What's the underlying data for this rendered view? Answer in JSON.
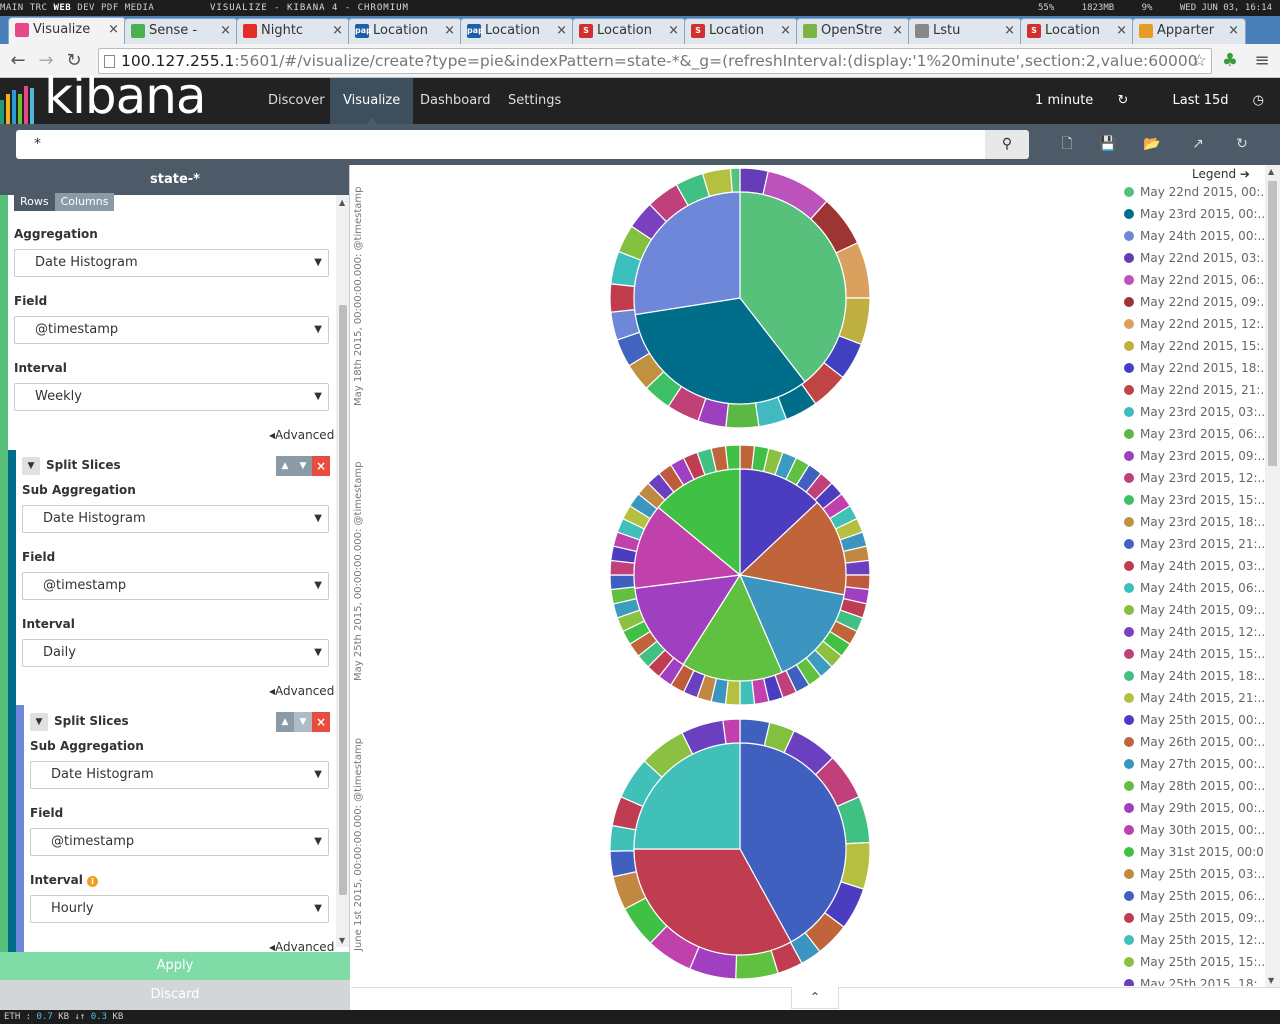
{
  "system_bar": {
    "workspaces": [
      "MAIN",
      "TRC",
      "WEB",
      "DEV",
      "PDF",
      "MEDIA"
    ],
    "active_workspace": "WEB",
    "window_title": "VISUALIZE - KIBANA 4 - CHROMIUM",
    "volume": "55%",
    "memory": "1823MB",
    "cpu": "9%",
    "datetime": "WED JUN 03, 16:14"
  },
  "browser": {
    "tabs": [
      {
        "label": "Visualize",
        "icon_color": "#e8488b",
        "active": true
      },
      {
        "label": "Sense - ",
        "icon_color": "#4caf50",
        "active": false
      },
      {
        "label": "Nightc",
        "icon_color": "#e52d27",
        "active": false
      },
      {
        "label": "Location",
        "icon_color": "#1c5fa8",
        "icon_text": "pap",
        "active": false
      },
      {
        "label": "Location",
        "icon_color": "#1c5fa8",
        "icon_text": "pap",
        "active": false
      },
      {
        "label": "Location",
        "icon_color": "#d32f2f",
        "icon_text": "S",
        "active": false
      },
      {
        "label": "Location",
        "icon_color": "#d32f2f",
        "icon_text": "S",
        "active": false
      },
      {
        "label": "OpenStre",
        "icon_color": "#7cb342",
        "active": false
      },
      {
        "label": "Lstu",
        "icon_color": "#888888",
        "active": false
      },
      {
        "label": "Location",
        "icon_color": "#d32f2f",
        "icon_text": "S",
        "active": false
      },
      {
        "label": "Apparter",
        "icon_color": "#e69c24",
        "active": false
      }
    ],
    "url_host": "100.127.255.1",
    "url_rest": ":5601/#/visualize/create?type=pie&indexPattern=state-*&_g=(refreshInterval:(display:'1%20minute',section:2,value:60000"
  },
  "kibana": {
    "logo": "kibana",
    "nav": [
      "Discover",
      "Visualize",
      "Dashboard",
      "Settings"
    ],
    "active_nav": "Visualize",
    "refresh_label": "1 minute",
    "time_label": "Last 15d",
    "search_value": "*"
  },
  "sidebar": {
    "title": "state-*",
    "rows_label": "Rows",
    "columns_label": "Columns",
    "aggregation_label": "Aggregation",
    "aggregation_value": "Date Histogram",
    "field_label": "Field",
    "field_value": "@timestamp",
    "interval_label": "Interval",
    "interval_value": "Weekly",
    "advanced_label": "Advanced",
    "split1": {
      "title": "Split Slices",
      "sub_agg_label": "Sub Aggregation",
      "sub_agg_value": "Date Histogram",
      "field_label": "Field",
      "field_value": "@timestamp",
      "interval_label": "Interval",
      "interval_value": "Daily",
      "advanced_label": "Advanced"
    },
    "split2": {
      "title": "Split Slices",
      "sub_agg_label": "Sub Aggregation",
      "sub_agg_value": "Date Histogram",
      "field_label": "Field",
      "field_value": "@timestamp",
      "interval_label": "Interval",
      "interval_value": "Hourly",
      "advanced_label": "Advanced"
    },
    "apply_label": "Apply",
    "discard_label": "Discard"
  },
  "charts": {
    "row_labels": [
      "May 18th 2015, 00:00:00.000: @timestamp",
      "May 25th 2015, 00:00:00.000: @timestamp",
      "June 1st 2015, 00:00:00.000: @timestamp"
    ],
    "legend_title": "Legend",
    "legend": [
      {
        "label": "May 22nd 2015, 00:...",
        "color": "#57c17b"
      },
      {
        "label": "May 23rd 2015, 00:...",
        "color": "#006e8a"
      },
      {
        "label": "May 24th 2015, 00:...",
        "color": "#6f87d8"
      },
      {
        "label": "May 22nd 2015, 03:...",
        "color": "#663db8"
      },
      {
        "label": "May 22nd 2015, 06:...",
        "color": "#bc52bc"
      },
      {
        "label": "May 22nd 2015, 09:...",
        "color": "#9e3533"
      },
      {
        "label": "May 22nd 2015, 12:...",
        "color": "#daa05d"
      },
      {
        "label": "May 22nd 2015, 15:...",
        "color": "#bfaf40"
      },
      {
        "label": "May 22nd 2015, 18:...",
        "color": "#4040c0"
      },
      {
        "label": "May 22nd 2015, 21:...",
        "color": "#c14444"
      },
      {
        "label": "May 23rd 2015, 03:...",
        "color": "#40b9c0"
      },
      {
        "label": "May 23rd 2015, 06:...",
        "color": "#5cb844"
      },
      {
        "label": "May 23rd 2015, 09:...",
        "color": "#9c40c0"
      },
      {
        "label": "May 23rd 2015, 12:...",
        "color": "#c04078"
      },
      {
        "label": "May 23rd 2015, 15:...",
        "color": "#40c066"
      },
      {
        "label": "May 23rd 2015, 18:...",
        "color": "#c0913e"
      },
      {
        "label": "May 23rd 2015, 21:...",
        "color": "#4064c0"
      },
      {
        "label": "May 24th 2015, 03:...",
        "color": "#c03c4c"
      },
      {
        "label": "May 24th 2015, 06:...",
        "color": "#3cc0bd"
      },
      {
        "label": "May 24th 2015, 09:...",
        "color": "#84c040"
      },
      {
        "label": "May 24th 2015, 12:...",
        "color": "#7a40c0"
      },
      {
        "label": "May 24th 2015, 15:...",
        "color": "#c0407c"
      },
      {
        "label": "May 24th 2015, 18:...",
        "color": "#40c082"
      },
      {
        "label": "May 24th 2015, 21:...",
        "color": "#b6c040"
      },
      {
        "label": "May 25th 2015, 00:...",
        "color": "#4c3cc0"
      },
      {
        "label": "May 26th 2015, 00:...",
        "color": "#c0643c"
      },
      {
        "label": "May 27th 2015, 00:...",
        "color": "#3c94c0"
      },
      {
        "label": "May 28th 2015, 00:...",
        "color": "#60c040"
      },
      {
        "label": "May 29th 2015, 00:...",
        "color": "#a040c0"
      },
      {
        "label": "May 30th 2015, 00:...",
        "color": "#c040ac"
      },
      {
        "label": "May 31st 2015, 00:0...",
        "color": "#40c044"
      },
      {
        "label": "May 25th 2015, 03:...",
        "color": "#c08840"
      },
      {
        "label": "May 25th 2015, 06:...",
        "color": "#4060c0"
      },
      {
        "label": "May 25th 2015, 09:...",
        "color": "#c03c50"
      },
      {
        "label": "May 25th 2015, 12:...",
        "color": "#40c0b8"
      },
      {
        "label": "May 25th 2015, 15:...",
        "color": "#8cc040"
      },
      {
        "label": "May 25th 2015, 18:...",
        "color": "#6a40c0"
      }
    ],
    "pies": [
      {
        "inner": [
          {
            "v": 39.5,
            "c": "#57c17b"
          },
          {
            "v": 33,
            "c": "#006e8a"
          },
          {
            "v": 27.5,
            "c": "#6f87d8"
          }
        ],
        "outer": [
          {
            "v": 3,
            "c": "#663db8"
          },
          {
            "v": 7,
            "c": "#bc52bc"
          },
          {
            "v": 5.5,
            "c": "#9e3533"
          },
          {
            "v": 6,
            "c": "#daa05d"
          },
          {
            "v": 5,
            "c": "#bfaf40"
          },
          {
            "v": 4,
            "c": "#4040c0"
          },
          {
            "v": 4,
            "c": "#c14444"
          },
          {
            "v": 3.5,
            "c": "#006e8a"
          },
          {
            "v": 3,
            "c": "#40b9c0"
          },
          {
            "v": 3.5,
            "c": "#5cb844"
          },
          {
            "v": 3,
            "c": "#9c40c0"
          },
          {
            "v": 3.5,
            "c": "#c04078"
          },
          {
            "v": 3,
            "c": "#40c066"
          },
          {
            "v": 3,
            "c": "#c0913e"
          },
          {
            "v": 3,
            "c": "#4064c0"
          },
          {
            "v": 3,
            "c": "#6f87d8"
          },
          {
            "v": 3,
            "c": "#c03c4c"
          },
          {
            "v": 3.5,
            "c": "#3cc0bd"
          },
          {
            "v": 3,
            "c": "#84c040"
          },
          {
            "v": 3,
            "c": "#7a40c0"
          },
          {
            "v": 3.5,
            "c": "#c0407c"
          },
          {
            "v": 3,
            "c": "#40c082"
          },
          {
            "v": 3,
            "c": "#b6c040"
          },
          {
            "v": 1,
            "c": "#57c17b"
          }
        ]
      },
      {
        "inner": [
          {
            "v": 13,
            "c": "#4c3cc0"
          },
          {
            "v": 15,
            "c": "#c0643c"
          },
          {
            "v": 15.5,
            "c": "#3c94c0"
          },
          {
            "v": 15.5,
            "c": "#60c040"
          },
          {
            "v": 14,
            "c": "#a040c0"
          },
          {
            "v": 13,
            "c": "#c040ac"
          },
          {
            "v": 14,
            "c": "#40c044"
          }
        ],
        "outer_count": 56
      },
      {
        "inner": [
          {
            "v": 42,
            "c": "#4060c0"
          },
          {
            "v": 33,
            "c": "#c03c50"
          },
          {
            "v": 25,
            "c": "#40c0b8"
          }
        ],
        "outer": [
          {
            "v": 3.5,
            "c": "#4060c0"
          },
          {
            "v": 3,
            "c": "#84c040"
          },
          {
            "v": 5.5,
            "c": "#6a40c0"
          },
          {
            "v": 5.5,
            "c": "#c0407c"
          },
          {
            "v": 5.5,
            "c": "#40c082"
          },
          {
            "v": 5.5,
            "c": "#b6c040"
          },
          {
            "v": 5,
            "c": "#4c3cc0"
          },
          {
            "v": 4,
            "c": "#c0643c"
          },
          {
            "v": 2.5,
            "c": "#3c94c0"
          },
          {
            "v": 3,
            "c": "#c03c50"
          },
          {
            "v": 5,
            "c": "#60c040"
          },
          {
            "v": 5.5,
            "c": "#a040c0"
          },
          {
            "v": 5.5,
            "c": "#c040ac"
          },
          {
            "v": 5,
            "c": "#40c044"
          },
          {
            "v": 4,
            "c": "#c08840"
          },
          {
            "v": 3,
            "c": "#4060c0"
          },
          {
            "v": 3,
            "c": "#40c0b8"
          },
          {
            "v": 3.5,
            "c": "#c03c50"
          },
          {
            "v": 5,
            "c": "#40c0b8"
          },
          {
            "v": 5.5,
            "c": "#8cc040"
          },
          {
            "v": 5,
            "c": "#6a40c0"
          },
          {
            "v": 2,
            "c": "#c040ac"
          }
        ]
      }
    ]
  },
  "status_bar": {
    "iface": "ETH",
    "down": "0.7",
    "up": "0.3",
    "unit": "KB"
  }
}
